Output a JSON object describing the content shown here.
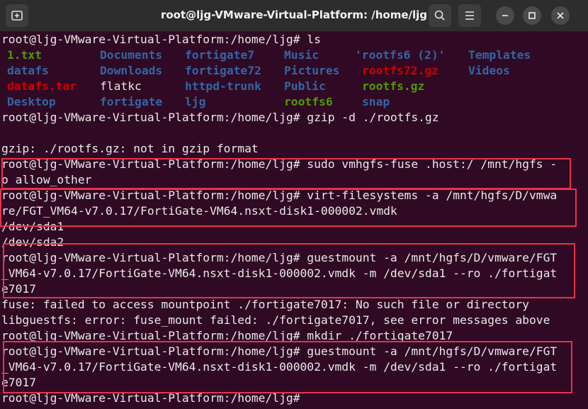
{
  "window": {
    "title": "root@ljg-VMware-Virtual-Platform: /home/ljg"
  },
  "ls": [
    {
      "text": "1.txt",
      "cls": "green"
    },
    {
      "text": "Documents",
      "cls": "blue"
    },
    {
      "text": "fortigate7",
      "cls": "blue"
    },
    {
      "text": "Music",
      "cls": "blue"
    },
    {
      "text": "'rootfs6 (2)'",
      "cls": "blue"
    },
    {
      "text": "Templates",
      "cls": "blue"
    },
    {
      "text": "datafs",
      "cls": "blue"
    },
    {
      "text": "Downloads",
      "cls": "blue"
    },
    {
      "text": "fortigate72",
      "cls": "blue"
    },
    {
      "text": "Pictures",
      "cls": "blue"
    },
    {
      "text": "rootfs72.gz",
      "cls": "red"
    },
    {
      "text": "Videos",
      "cls": "blue"
    },
    {
      "text": "datafs.tar",
      "cls": "red"
    },
    {
      "text": "flatkc",
      "cls": "plain"
    },
    {
      "text": "httpd-trunk",
      "cls": "blue"
    },
    {
      "text": "Public",
      "cls": "blue"
    },
    {
      "text": "rootfs.gz",
      "cls": "green"
    },
    {
      "text": "Desktop",
      "cls": "blue"
    },
    {
      "text": "fortigate",
      "cls": "blue"
    },
    {
      "text": "ljg",
      "cls": "blue"
    },
    {
      "text": "rootfs6",
      "cls": "green"
    },
    {
      "text": "snap",
      "cls": "blue"
    }
  ],
  "lines": [
    "root@ljg-VMware-Virtual-Platform:/home/ljg# ls",
    "root@ljg-VMware-Virtual-Platform:/home/ljg# gzip -d ./rootfs.gz",
    "gzip: ./rootfs.gz: not in gzip format",
    "root@ljg-VMware-Virtual-Platform:/home/ljg# sudo vmhgfs-fuse .host:/ /mnt/hgfs -",
    "o allow_other",
    "root@ljg-VMware-Virtual-Platform:/home/ljg# virt-filesystems -a /mnt/hgfs/D/vmwa",
    "re/FGT_VM64-v7.0.17/FortiGate-VM64.nsxt-disk1-000002.vmdk",
    "/dev/sda1",
    "/dev/sda2",
    "root@ljg-VMware-Virtual-Platform:/home/ljg# guestmount -a /mnt/hgfs/D/vmware/FGT",
    "_VM64-v7.0.17/FortiGate-VM64.nsxt-disk1-000002.vmdk -m /dev/sda1 --ro ./fortigat",
    "e7017",
    "fuse: failed to access mountpoint ./fortigate7017: No such file or directory",
    "libguestfs: error: fuse_mount failed: ./fortigate7017, see error messages above",
    "root@ljg-VMware-Virtual-Platform:/home/ljg# mkdir ./fortigate7017",
    "root@ljg-VMware-Virtual-Platform:/home/ljg# guestmount -a /mnt/hgfs/D/vmware/FGT",
    "_VM64-v7.0.17/FortiGate-VM64.nsxt-disk1-000002.vmdk -m /dev/sda1 --ro ./fortigat",
    "e7017",
    "root@ljg-VMware-Virtual-Platform:/home/ljg# "
  ]
}
